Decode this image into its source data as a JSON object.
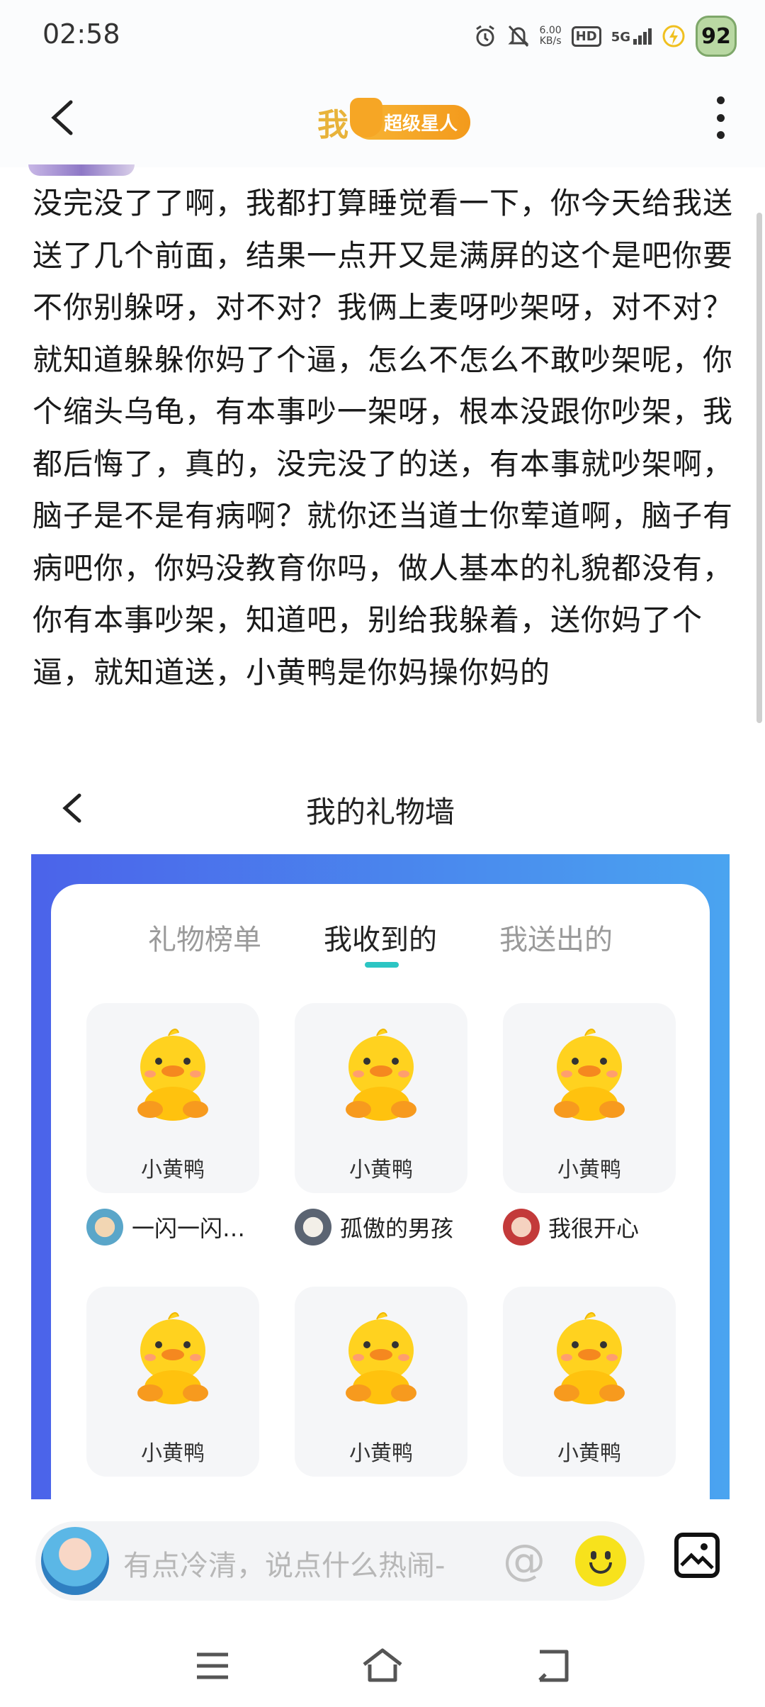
{
  "status_bar": {
    "time": "02:58",
    "net_speed": "6.00",
    "net_unit": "KB/s",
    "hd": "HD",
    "network": "5G",
    "battery": "92"
  },
  "header": {
    "title": "我",
    "badge": "超级星人"
  },
  "post": {
    "text": "没完没了了啊，我都打算睡觉看一下，你今天给我送送了几个前面，结果一点开又是满屏的这个是吧你要不你别躲呀，对不对？我俩上麦呀吵架呀，对不对？就知道躲躲你妈了个逼，怎么不怎么不敢吵架呢，你个缩头乌龟，有本事吵一架呀，根本没跟你吵架，我都后悔了，真的，没完没了的送，有本事就吵架啊，脑子是不是有病啊？就你还当道士你荤道啊，脑子有病吧你，你妈没教育你吗，做人基本的礼貌都没有，你有本事吵架，知道吧，别给我躲着，送你妈了个逼，就知道送，小黄鸭是你妈操你妈的"
  },
  "screenshot": {
    "title": "我的礼物墙",
    "tabs": [
      "礼物榜单",
      "我收到的",
      "我送出的"
    ],
    "active_tab": "我收到的",
    "gifts": [
      {
        "name": "小黄鸭",
        "sender": "一闪一闪…"
      },
      {
        "name": "小黄鸭",
        "sender": "孤傲的男孩"
      },
      {
        "name": "小黄鸭",
        "sender": "我很开心"
      },
      {
        "name": "小黄鸭",
        "sender": ""
      },
      {
        "name": "小黄鸭",
        "sender": ""
      },
      {
        "name": "小黄鸭",
        "sender": ""
      }
    ]
  },
  "composer": {
    "placeholder": "有点冷清，说点什么热闹-",
    "at_symbol": "@"
  },
  "colors": {
    "accent_gold": "#e8b33a",
    "tab_indicator": "#2cc5c3",
    "gift_wall_gradient_start": "#4b63ea",
    "gift_wall_gradient_end": "#4aa4f0"
  },
  "icons": [
    "back-icon",
    "more-icon",
    "alarm-icon",
    "mute-icon",
    "signal-icon",
    "charging-icon",
    "duck-gift-icon",
    "emoji-icon",
    "image-icon",
    "menu-icon",
    "home-icon",
    "return-icon"
  ]
}
